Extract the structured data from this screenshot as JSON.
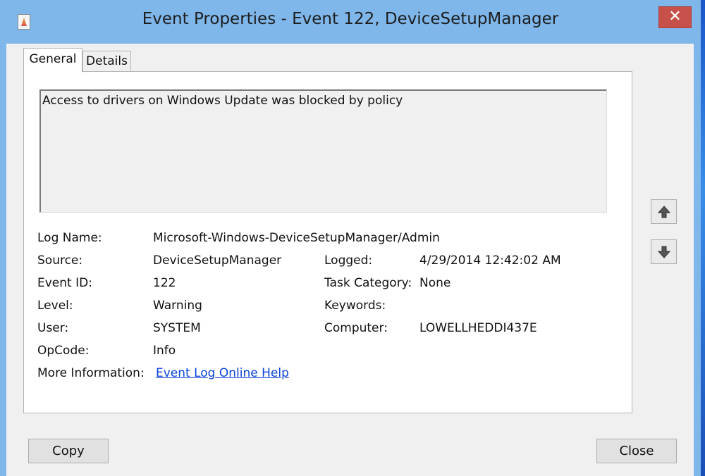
{
  "window": {
    "title": "Event Properties - Event 122, DeviceSetupManager",
    "close_glyph": "✕"
  },
  "tabs": [
    {
      "label": "General",
      "selected": true
    },
    {
      "label": "Details",
      "selected": false
    }
  ],
  "description": "Access to drivers on Windows Update was blocked by policy",
  "fields": {
    "log_name": {
      "label": "Log Name:",
      "value": "Microsoft-Windows-DeviceSetupManager/Admin"
    },
    "source": {
      "label": "Source:",
      "value": "DeviceSetupManager"
    },
    "logged": {
      "label": "Logged:",
      "value": "4/29/2014 12:42:02 AM"
    },
    "event_id": {
      "label": "Event ID:",
      "value": "122"
    },
    "task_category": {
      "label": "Task Category:",
      "value": "None"
    },
    "level": {
      "label": "Level:",
      "value": "Warning"
    },
    "keywords": {
      "label": "Keywords:",
      "value": ""
    },
    "user": {
      "label": "User:",
      "value": "SYSTEM"
    },
    "computer": {
      "label": "Computer:",
      "value": "LOWELLHEDDI437E"
    },
    "opcode": {
      "label": "OpCode:",
      "value": "Info"
    },
    "more_info": {
      "label": "More Information:",
      "link_text": "Event Log Online Help"
    }
  },
  "nav": {
    "up_icon": "arrow-up-icon",
    "down_icon": "arrow-down-icon"
  },
  "buttons": {
    "copy": "Copy",
    "close": "Close"
  },
  "colors": {
    "titlebar": "#7fb7eb",
    "close_button": "#c7504a",
    "link": "#0b44d8"
  }
}
